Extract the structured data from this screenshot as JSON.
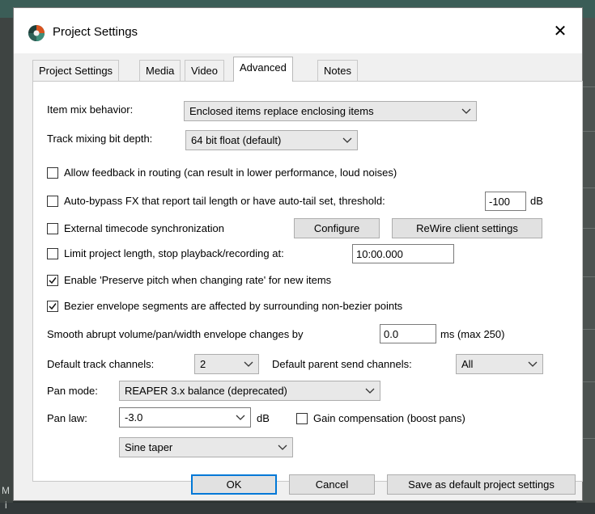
{
  "dialog": {
    "title": "Project Settings",
    "close_symbol": "✕"
  },
  "tabs": [
    "Project Settings",
    "Media",
    "Video",
    "Advanced",
    "Notes"
  ],
  "fields": {
    "item_mix_label": "Item mix behavior:",
    "item_mix_value": "Enclosed items replace enclosing items",
    "bit_depth_label": "Track mixing bit depth:",
    "bit_depth_value": "64 bit float (default)",
    "feedback_label": "Allow feedback in routing (can result in lower performance, loud noises)",
    "autobypass_label": "Auto-bypass FX that report tail length or have auto-tail set, threshold:",
    "autobypass_threshold": "-100",
    "autobypass_unit": "dB",
    "timecode_label": "External timecode synchronization",
    "configure_label": "Configure",
    "rewire_label": "ReWire client settings",
    "limit_label": "Limit project length, stop playback/recording at:",
    "limit_value": "10:00.000",
    "preserve_pitch_label": "Enable 'Preserve pitch when changing rate' for new items",
    "bezier_label": "Bezier envelope segments are affected by surrounding non-bezier points",
    "smooth_label": "Smooth abrupt volume/pan/width envelope changes by",
    "smooth_value": "0.0",
    "smooth_unit": "ms (max 250)",
    "track_channels_label": "Default track channels:",
    "track_channels_value": "2",
    "parent_send_label": "Default parent send channels:",
    "parent_send_value": "All",
    "pan_mode_label": "Pan mode:",
    "pan_mode_value": "REAPER 3.x balance (deprecated)",
    "pan_law_label": "Pan law:",
    "pan_law_value": "-3.0",
    "pan_law_unit": "dB",
    "gain_comp_label": "Gain compensation (boost pans)",
    "taper_value": "Sine taper"
  },
  "checkboxes": {
    "feedback": false,
    "autobypass": false,
    "timecode": false,
    "limit": false,
    "preserve_pitch": true,
    "bezier": true,
    "gain_comp": false
  },
  "buttons": {
    "ok": "OK",
    "cancel": "Cancel",
    "save_default": "Save as default project settings"
  },
  "background": {
    "letter_a": "M",
    "letter_b": "i"
  }
}
